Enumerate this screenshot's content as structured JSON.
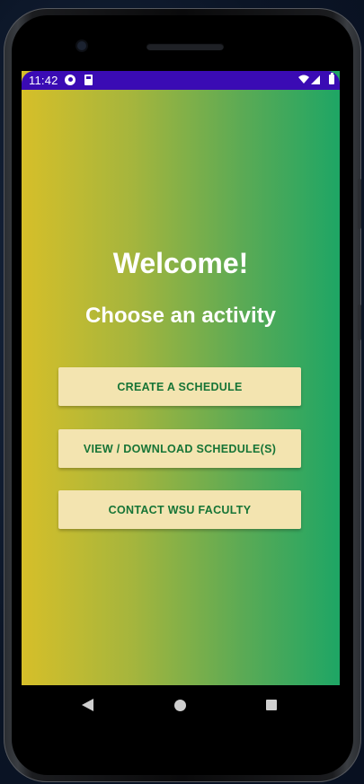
{
  "status_bar": {
    "time": "11:42",
    "icons": [
      "notification-circle-icon",
      "sd-card-icon",
      "wifi-icon",
      "signal-icon",
      "battery-icon"
    ],
    "background_color": "#3a0bb4"
  },
  "main": {
    "title": "Welcome!",
    "subtitle": "Choose an activity",
    "gradient_colors": [
      "#d6bf29",
      "#1ea665"
    ],
    "buttons": [
      {
        "label": "CREATE A SCHEDULE"
      },
      {
        "label": "VIEW / DOWNLOAD SCHEDULE(S)"
      },
      {
        "label": "CONTACT WSU FACULTY"
      }
    ],
    "button_color": "#f3e4b0",
    "button_text_color": "#167436"
  },
  "nav_bar": {
    "icons": [
      "back-icon",
      "home-icon",
      "recent-apps-icon"
    ]
  }
}
